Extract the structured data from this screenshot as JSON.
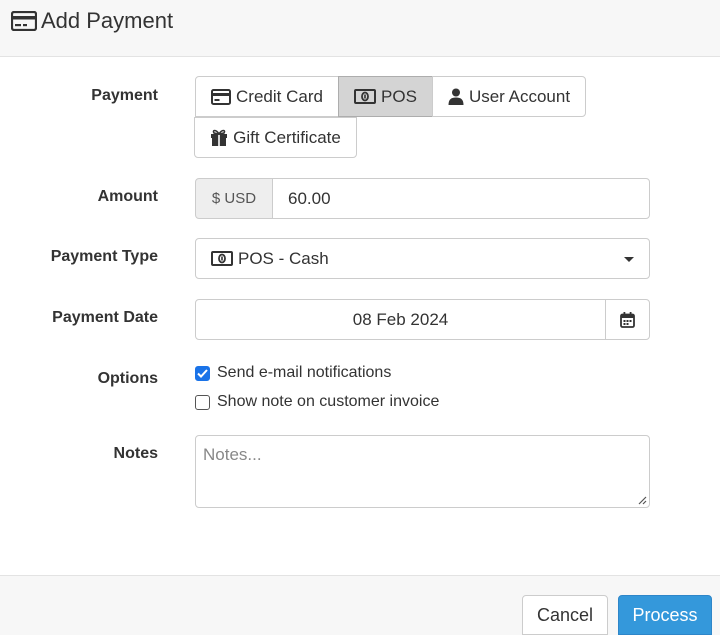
{
  "header": {
    "title": "Add Payment",
    "icon": "credit-card-icon"
  },
  "labels": {
    "payment": "Payment",
    "amount": "Amount",
    "payment_type": "Payment Type",
    "payment_date": "Payment Date",
    "options": "Options",
    "notes": "Notes"
  },
  "payment_methods": [
    {
      "label": "Credit Card",
      "icon": "credit-card-icon",
      "active": false
    },
    {
      "label": "POS",
      "icon": "money-bill-icon",
      "active": true
    },
    {
      "label": "User Account",
      "icon": "user-icon",
      "active": false
    },
    {
      "label": "Gift Certificate",
      "icon": "gift-icon",
      "active": false
    }
  ],
  "amount": {
    "currency": "$ USD",
    "value": "60.00"
  },
  "payment_type": {
    "selected": "POS - Cash"
  },
  "payment_date": {
    "value": "08 Feb 2024"
  },
  "options": [
    {
      "label": "Send e-mail notifications",
      "checked": true
    },
    {
      "label": "Show note on customer invoice",
      "checked": false
    }
  ],
  "notes": {
    "placeholder": "Notes..."
  },
  "footer": {
    "cancel": "Cancel",
    "process": "Process"
  },
  "colors": {
    "primary": "#3498db",
    "checkbox": "#1a73e8",
    "active_bg": "#d4d4d4"
  }
}
